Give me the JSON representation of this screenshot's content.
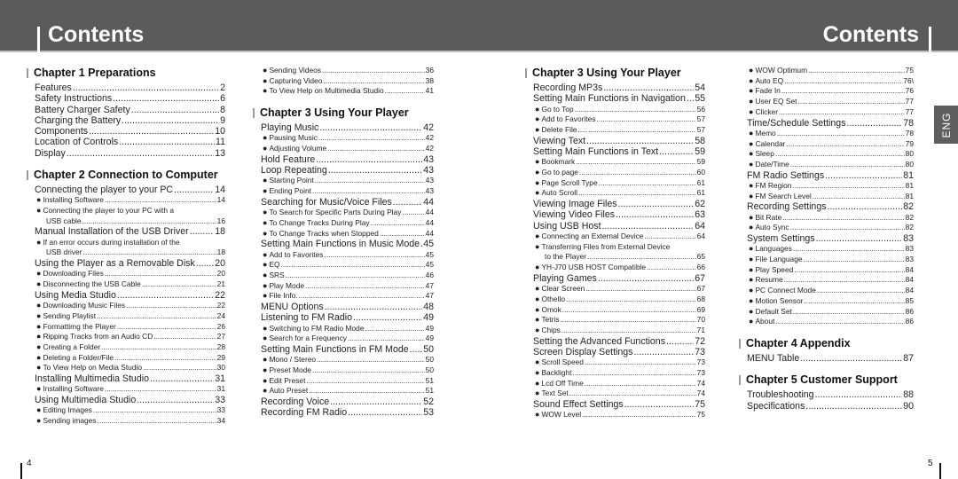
{
  "header": {
    "left_title": "Contents",
    "right_title": "Contents"
  },
  "side_tab": "ENG",
  "page_numbers": {
    "left": "4",
    "right": "5"
  },
  "columns": [
    [
      {
        "type": "chapter",
        "label": "Chapter 1  Preparations"
      },
      {
        "type": "l1",
        "text": "Features",
        "page": "2"
      },
      {
        "type": "l1",
        "text": "Safety Instructions",
        "page": "6"
      },
      {
        "type": "l1",
        "text": "Battery Charger Safety",
        "page": "8"
      },
      {
        "type": "l1",
        "text": "Charging the Battery",
        "page": "9"
      },
      {
        "type": "l1",
        "text": "Components",
        "page": "10"
      },
      {
        "type": "l1",
        "text": "Location of Controls",
        "page": "11"
      },
      {
        "type": "l1",
        "text": "Display",
        "page": "13"
      },
      {
        "type": "spacer"
      },
      {
        "type": "chapter",
        "label": "Chapter 2  Connection to Computer"
      },
      {
        "type": "l1",
        "text": "Connecting the player to your PC",
        "page": "14"
      },
      {
        "type": "l2",
        "text": "Installing Software",
        "page": "14"
      },
      {
        "type": "l2wrap",
        "text": "Connecting the player to your PC with a",
        "cont": "USB cable",
        "page": "16"
      },
      {
        "type": "l1",
        "text": "Manual Installation of the USB Driver",
        "page": "18"
      },
      {
        "type": "l2wrap",
        "text": "If an error occurs during installation of the",
        "cont": "USB driver",
        "page": "18"
      },
      {
        "type": "l1",
        "text": "Using the Player as a Removable Disk",
        "page": "20"
      },
      {
        "type": "l2",
        "text": "Downloading Files",
        "page": "20"
      },
      {
        "type": "l2",
        "text": "Disconnecting the USB Cable",
        "page": "21"
      },
      {
        "type": "l1",
        "text": "Using Media Studio",
        "page": "22"
      },
      {
        "type": "l2",
        "text": "Downloading Music Files",
        "page": "22"
      },
      {
        "type": "l2",
        "text": "Sending Playlist",
        "page": "24"
      },
      {
        "type": "l2",
        "text": "Formattimg the Player",
        "page": "26"
      },
      {
        "type": "l2",
        "text": "Ripping Tracks from an Audio CD",
        "page": "27"
      },
      {
        "type": "l2",
        "text": "Creating a Folder",
        "page": "28"
      },
      {
        "type": "l2",
        "text": "Deleting a Folder/File",
        "page": "29"
      },
      {
        "type": "l2",
        "text": "To View Help on Media Studio",
        "page": "30"
      },
      {
        "type": "l1",
        "text": "Installing Multimedia Studio",
        "page": "31"
      },
      {
        "type": "l2",
        "text": "Installing Software",
        "page": "31"
      },
      {
        "type": "l1",
        "text": "Using Multimedia Studio",
        "page": "33"
      },
      {
        "type": "l2",
        "text": "Editing Images",
        "page": "33"
      },
      {
        "type": "l2",
        "text": "Sending images",
        "page": "34"
      }
    ],
    [
      {
        "type": "l2",
        "text": "Sending Videos",
        "page": "36"
      },
      {
        "type": "l2",
        "text": "Capturing Video",
        "page": "38"
      },
      {
        "type": "l2",
        "text": "To View Help on Multimedia Studio",
        "page": "41"
      },
      {
        "type": "spacer"
      },
      {
        "type": "chapter",
        "label": "Chapter 3  Using Your Player"
      },
      {
        "type": "l1",
        "text": "Playing Music",
        "page": "42"
      },
      {
        "type": "l2",
        "text": "Pausing Music",
        "page": "42"
      },
      {
        "type": "l2",
        "text": "Adjusting Volume",
        "page": "42"
      },
      {
        "type": "l1",
        "text": "Hold Feature",
        "page": "43"
      },
      {
        "type": "l1",
        "text": "Loop Repeating",
        "page": "43"
      },
      {
        "type": "l2",
        "text": "Starting Point",
        "page": "43"
      },
      {
        "type": "l2",
        "text": "Ending Point",
        "page": "43"
      },
      {
        "type": "l1",
        "text": "Searching for Music/Voice Files",
        "page": "44"
      },
      {
        "type": "l2",
        "text": "To Search for Specific Parts During Play",
        "page": "44"
      },
      {
        "type": "l2",
        "text": "To Change Tracks During Play",
        "page": "44"
      },
      {
        "type": "l2",
        "text": "To Change Tracks when Stopped",
        "page": "44"
      },
      {
        "type": "l1",
        "text": "Setting Main Functions in Music Mode",
        "page": "45"
      },
      {
        "type": "l2",
        "text": "Add to Favorites",
        "page": "45"
      },
      {
        "type": "l2",
        "text": "EQ",
        "page": "45"
      },
      {
        "type": "l2",
        "text": "SRS",
        "page": "46"
      },
      {
        "type": "l2",
        "text": "Play Mode",
        "page": "47"
      },
      {
        "type": "l2",
        "text": "File Info.",
        "page": "47"
      },
      {
        "type": "l1",
        "text": "MENU Options",
        "page": "48"
      },
      {
        "type": "l1",
        "text": "Listening to FM Radio",
        "page": "49"
      },
      {
        "type": "l2",
        "text": "Switching to FM Radio Mode",
        "page": "49"
      },
      {
        "type": "l2",
        "text": "Search for a Frequency",
        "page": "49"
      },
      {
        "type": "l1",
        "text": "Setting Main Functions in FM Mode",
        "page": "50"
      },
      {
        "type": "l2",
        "text": "Mono / Stereo",
        "page": "50"
      },
      {
        "type": "l2",
        "text": "Preset Mode",
        "page": "50"
      },
      {
        "type": "l2",
        "text": "Edit Preset",
        "page": "51"
      },
      {
        "type": "l2",
        "text": "Auto Preset",
        "page": "51"
      },
      {
        "type": "l1",
        "text": "Recording Voice",
        "page": "52"
      },
      {
        "type": "l1",
        "text": "Recording FM Radio",
        "page": "53"
      }
    ],
    [
      {
        "type": "chapter",
        "label": "Chapter 3  Using Your Player"
      },
      {
        "type": "l1",
        "text": "Recording MP3s",
        "page": "54"
      },
      {
        "type": "l1",
        "text": "Setting Main Functions in Navigation",
        "page": "55"
      },
      {
        "type": "l2",
        "text": "Go to Top",
        "page": "56"
      },
      {
        "type": "l2",
        "text": "Add to Favorites",
        "page": "57"
      },
      {
        "type": "l2",
        "text": "Delete File",
        "page": "57"
      },
      {
        "type": "l1",
        "text": "Viewing Text",
        "page": "58"
      },
      {
        "type": "l1",
        "text": "Setting Main Functions in Text",
        "page": "59"
      },
      {
        "type": "l2",
        "text": "Bookmark",
        "page": "59"
      },
      {
        "type": "l2",
        "text": "Go to page",
        "page": "60"
      },
      {
        "type": "l2",
        "text": "Page Scroll Type",
        "page": "61"
      },
      {
        "type": "l2",
        "text": "Auto Scroll",
        "page": "61"
      },
      {
        "type": "l1",
        "text": "Viewing Image Files",
        "page": "62"
      },
      {
        "type": "l1",
        "text": "Viewing Video Files",
        "page": "63"
      },
      {
        "type": "l1",
        "text": "Using USB Host",
        "page": "64"
      },
      {
        "type": "l2",
        "text": "Connecting an External Device",
        "page": "64"
      },
      {
        "type": "l2wrap",
        "text": "Transferring Files from External Device",
        "cont": "to the Player",
        "page": "65"
      },
      {
        "type": "l2",
        "text": "YH-J70 USB HOST Compatible",
        "page": "66"
      },
      {
        "type": "l1",
        "text": "Playing Games",
        "page": "67"
      },
      {
        "type": "l2",
        "text": "Clear Screen",
        "page": "67"
      },
      {
        "type": "l2",
        "text": "Othello",
        "page": "68"
      },
      {
        "type": "l2",
        "text": "Omok",
        "page": "69"
      },
      {
        "type": "l2",
        "text": "Tetris",
        "page": "70"
      },
      {
        "type": "l2",
        "text": "Chips",
        "page": "71"
      },
      {
        "type": "l1",
        "text": "Setting the Advanced Functions",
        "page": "72"
      },
      {
        "type": "l1",
        "text": "Screen Display Settings",
        "page": "73"
      },
      {
        "type": "l2",
        "text": "Scroll Speed",
        "page": "73"
      },
      {
        "type": "l2",
        "text": "Backlight",
        "page": "73"
      },
      {
        "type": "l2",
        "text": "Lcd Off Time",
        "page": "74"
      },
      {
        "type": "l2",
        "text": "Text Set",
        "page": "74"
      },
      {
        "type": "l1",
        "text": "Sound Effect Settings",
        "page": "75"
      },
      {
        "type": "l2",
        "text": "WOW Level",
        "page": "75"
      }
    ],
    [
      {
        "type": "l2",
        "text": "WOW Optimum",
        "page": "75"
      },
      {
        "type": "l2",
        "text": "Auto EQ",
        "page": "76\\"
      },
      {
        "type": "l2",
        "text": "Fade In",
        "page": "76"
      },
      {
        "type": "l2",
        "text": "User EQ Set",
        "page": "77"
      },
      {
        "type": "l2",
        "text": "Clicker",
        "page": "77"
      },
      {
        "type": "l1",
        "text": "Time/Schedule Settings",
        "page": "78"
      },
      {
        "type": "l2",
        "text": "Memo",
        "page": "78"
      },
      {
        "type": "l2",
        "text": "Calendar",
        "page": "79"
      },
      {
        "type": "l2",
        "text": "Sleep",
        "page": "80"
      },
      {
        "type": "l2",
        "text": "Date/Time",
        "page": "80"
      },
      {
        "type": "l1",
        "text": "FM Radio Settings",
        "page": "81"
      },
      {
        "type": "l2",
        "text": "FM Region",
        "page": "81"
      },
      {
        "type": "l2",
        "text": "FM Search Level",
        "page": "81"
      },
      {
        "type": "l1",
        "text": "Recording Settings",
        "page": "82"
      },
      {
        "type": "l2",
        "text": "Bit Rate",
        "page": "82"
      },
      {
        "type": "l2",
        "text": "Auto Sync",
        "page": "82"
      },
      {
        "type": "l1",
        "text": "System Settings",
        "page": "83"
      },
      {
        "type": "l2",
        "text": "Languages",
        "page": "83"
      },
      {
        "type": "l2",
        "text": "File Language",
        "page": "83"
      },
      {
        "type": "l2",
        "text": "Play Speed",
        "page": "84"
      },
      {
        "type": "l2",
        "text": "Resume",
        "page": "84"
      },
      {
        "type": "l2",
        "text": "PC Connect Mode",
        "page": "84"
      },
      {
        "type": "l2",
        "text": "Motion Sensor",
        "page": "85"
      },
      {
        "type": "l2",
        "text": "Default Set",
        "page": "86"
      },
      {
        "type": "l2",
        "text": "About",
        "page": "86"
      },
      {
        "type": "spacer"
      },
      {
        "type": "chapter",
        "label": "Chapter 4  Appendix"
      },
      {
        "type": "l1",
        "text": "MENU Table",
        "page": "87"
      },
      {
        "type": "spacer"
      },
      {
        "type": "chapter",
        "label": "Chapter 5  Customer Support"
      },
      {
        "type": "l1",
        "text": "Troubleshooting",
        "page": "88"
      },
      {
        "type": "l1",
        "text": "Specifications",
        "page": "90"
      }
    ]
  ]
}
